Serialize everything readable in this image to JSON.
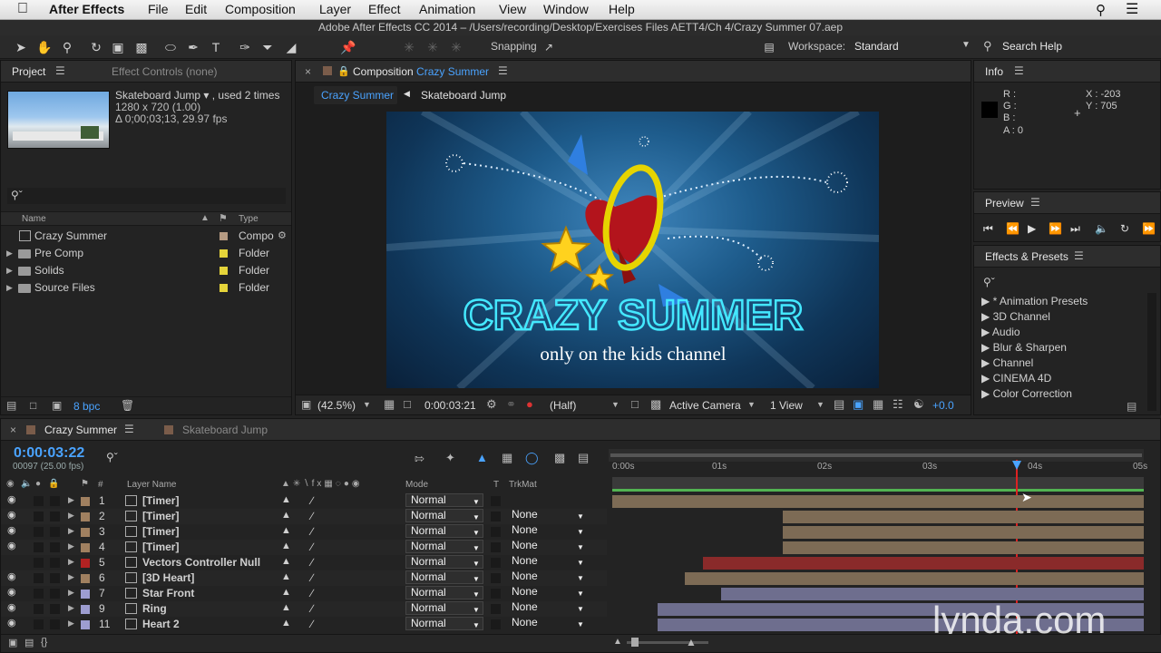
{
  "menubar": {
    "app": "After Effects",
    "items": [
      "File",
      "Edit",
      "Composition",
      "Layer",
      "Effect",
      "Animation",
      "View",
      "Window",
      "Help"
    ]
  },
  "title": "Adobe After Effects CC 2014 – /Users/recording/Desktop/Exercises Files AETT4/Ch 4/Crazy Summer 07.aep",
  "toolbar": {
    "snapping": "Snapping",
    "workspace_label": "Workspace:",
    "workspace_value": "Standard",
    "search": "Search Help"
  },
  "project": {
    "tab": "Project",
    "tab2": "Effect Controls (none)",
    "item_name": "Skateboard Jump ▾ , used 2 times",
    "item_size": "1280 x 720 (1.00)",
    "item_duration": "Δ 0;00;03;13, 29.97 fps",
    "col_name": "Name",
    "col_type": "Type",
    "items": [
      {
        "name": "Crazy Summer",
        "type": "Compo"
      },
      {
        "name": "Pre Comp",
        "type": "Folder"
      },
      {
        "name": "Solids",
        "type": "Folder"
      },
      {
        "name": "Source Files",
        "type": "Folder"
      }
    ],
    "bpc": "8 bpc"
  },
  "comp": {
    "tab_prefix": "Composition",
    "tab_name": "Crazy Summer",
    "nav1": "Crazy Summer",
    "nav2": "Skateboard Jump",
    "title_text": "CRAZY SUMMER",
    "subtitle_text": "only on the kids channel",
    "zoom": "(42.5%)",
    "timecode": "0:00:03:21",
    "resolution": "(Half)",
    "camera": "Active Camera",
    "views": "1 View",
    "exposure": "+0.0"
  },
  "info": {
    "tab": "Info",
    "r": "R :",
    "g": "G :",
    "b": "B :",
    "a": "A : 0",
    "x": "X : -203",
    "y": "Y : 705"
  },
  "preview": {
    "tab": "Preview"
  },
  "effects": {
    "tab": "Effects & Presets",
    "items": [
      "▶ * Animation Presets",
      "▶ 3D Channel",
      "▶ Audio",
      "▶ Blur & Sharpen",
      "▶ Channel",
      "▶ CINEMA 4D",
      "▶ Color Correction"
    ]
  },
  "timeline": {
    "tab1": "Crazy Summer",
    "tab2": "Skateboard Jump",
    "timecode": "0:00:03:22",
    "frames": "00097 (25.00 fps)",
    "col_num": "#",
    "col_layer": "Layer Name",
    "col_mode": "Mode",
    "col_t": "T",
    "col_trkmat": "TrkMat",
    "ruler": [
      "0:00s",
      "01s",
      "02s",
      "03s",
      "04s",
      "05s"
    ],
    "layers": [
      {
        "num": "1",
        "name": "[Timer]",
        "color": "#a08060",
        "mode": "Normal",
        "trk": ""
      },
      {
        "num": "2",
        "name": "[Timer]",
        "color": "#a08060",
        "mode": "Normal",
        "trk": "None"
      },
      {
        "num": "3",
        "name": "[Timer]",
        "color": "#a08060",
        "mode": "Normal",
        "trk": "None"
      },
      {
        "num": "4",
        "name": "[Timer]",
        "color": "#a08060",
        "mode": "Normal",
        "trk": "None"
      },
      {
        "num": "5",
        "name": "Vectors Controller Null",
        "color": "#b22222",
        "mode": "Normal",
        "trk": "None"
      },
      {
        "num": "6",
        "name": "[3D Heart]",
        "color": "#a08060",
        "mode": "Normal",
        "trk": "None"
      },
      {
        "num": "7",
        "name": "Star Front",
        "color": "#9d9dd0",
        "mode": "Normal",
        "trk": "None"
      },
      {
        "num": "9",
        "name": "Ring",
        "color": "#9d9dd0",
        "mode": "Normal",
        "trk": "None"
      },
      {
        "num": "11",
        "name": "Heart 2",
        "color": "#9d9dd0",
        "mode": "Normal",
        "trk": "None"
      }
    ]
  },
  "watermark": "lynda.com"
}
